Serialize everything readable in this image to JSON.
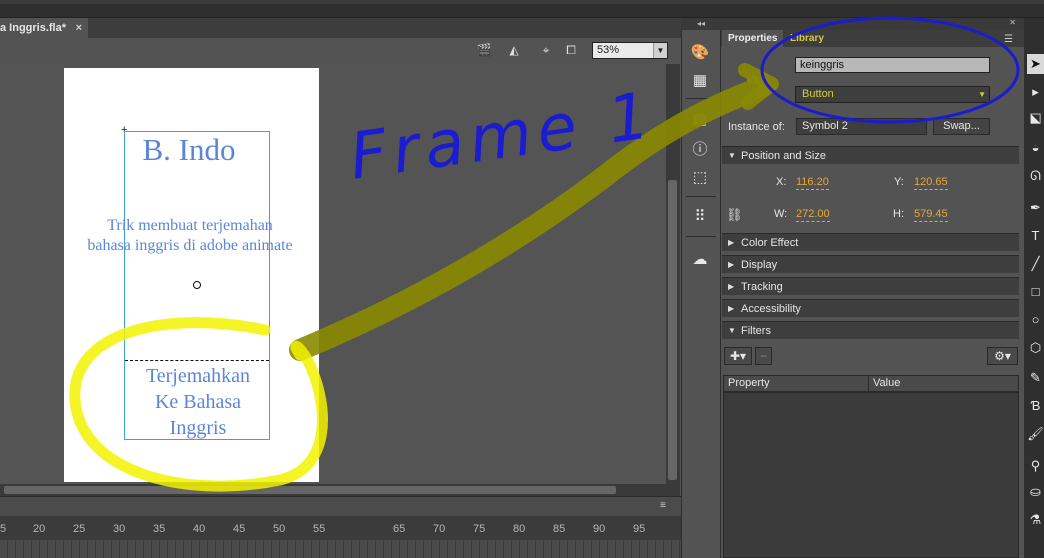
{
  "document": {
    "tab_title": "a Inggris.fla*",
    "tab_close": "×"
  },
  "stage_toolbar": {
    "zoom_value": "53%",
    "icons": [
      "clapper-icon",
      "symbol-icon",
      "snap-icon",
      "clip-icon"
    ]
  },
  "stage": {
    "heading": "B. Indo",
    "subtitle_line1": "Trik membuat terjemahan",
    "subtitle_line2": "bahasa inggris di adobe animate",
    "button_line1": "Terjemahkan",
    "button_line2": "Ke Bahasa",
    "button_line3": "Inggris"
  },
  "timeline": {
    "ticks": [
      "5",
      "20",
      "25",
      "30",
      "35",
      "40",
      "45",
      "50",
      "55",
      "65",
      "70",
      "75",
      "80",
      "85",
      "90",
      "95"
    ]
  },
  "properties": {
    "tab_properties": "Properties",
    "tab_library": "Library",
    "instance_name": "keinggris",
    "symbol_type": "Button",
    "instance_of_label": "Instance of:",
    "instance_of_value": "Symbol 2",
    "swap_label": "Swap...",
    "section_position": "Position and Size",
    "x_label": "X:",
    "x_value": "116.20",
    "y_label": "Y:",
    "y_value": "120.65",
    "w_label": "W:",
    "w_value": "272.00",
    "h_label": "H:",
    "h_value": "579.45",
    "section_color": "Color Effect",
    "section_display": "Display",
    "section_tracking": "Tracking",
    "section_accessibility": "Accessibility",
    "section_filters": "Filters",
    "filter_col_property": "Property",
    "filter_col_value": "Value"
  },
  "annotation": {
    "handwritten_text": "Frame 1",
    "pen_blue": "#1b1bd0",
    "marker_yellow": "#f2f200",
    "marker_olive": "#8a8a00"
  },
  "colors": {
    "stage_text": "#5b86d8",
    "value_orange": "#e3a63c",
    "library_tab": "#d8c84a"
  }
}
